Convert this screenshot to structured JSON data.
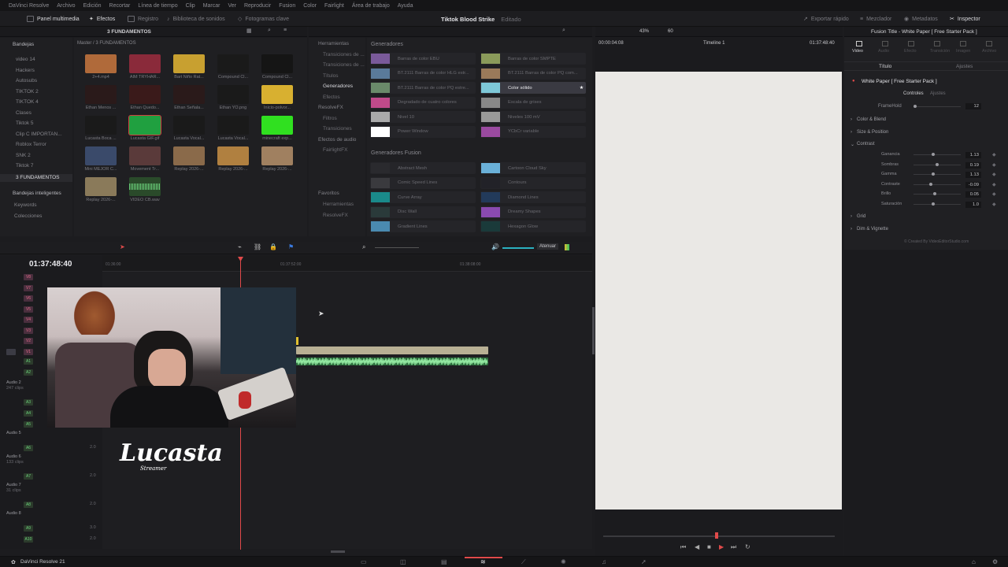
{
  "menu": [
    "DaVinci Resolve",
    "Archivo",
    "Edición",
    "Recortar",
    "Línea de tiempo",
    "Clip",
    "Marcar",
    "Ver",
    "Reproducir",
    "Fusion",
    "Color",
    "Fairlight",
    "Área de trabajo",
    "Ayuda"
  ],
  "toolbar": {
    "media_pool": "Panel multimedia",
    "effects": "Efectos",
    "index": "Registro",
    "sound_library": "Biblioteca de sonidos",
    "keyframes": "Fotogramas clave",
    "project_title": "Tiktok Blood Strike",
    "edited": "Editado",
    "quick_export": "Exportar rápido",
    "mixer": "Mezclador",
    "metadata": "Metadatos",
    "inspector": "Inspector"
  },
  "media_pool": {
    "bin_title": "3 FUNDAMENTOS",
    "breadcrumb": "Master / 3 FUNDAMENTOS",
    "bins_header": "Bandejas",
    "bins": [
      "video 14",
      "Hackers",
      "Autosubs",
      "TIKTOK 2",
      "TIKTOK 4",
      "Clases",
      "Tiktok 5",
      "Clip C IMPORTAN...",
      "Roblox Terror",
      "SNK 2",
      "Tiktok 7",
      "3 FUNDAMENTOS"
    ],
    "smart_bins_header": "Bandejas inteligentes",
    "smart_bins": [
      "Keywords",
      "Colecciones"
    ],
    "clips": [
      "2+4.mp4",
      "AIM TRYHAR...",
      "Bart Niño Rat...",
      "Compound Cl...",
      "Compound Cl...",
      "Ethan Menos ...",
      "Ethan Quedo...",
      "Ethan Señala...",
      "Ethan YO.png",
      "Inicio-polvor...",
      "Lucasta Boca ...",
      "Lucasta GIF.gif",
      "Lucasta Vocal...",
      "Lucasta Vocal...",
      "minecraft exp...",
      "Mini MEJOR C...",
      "Movement Tr...",
      "Replay 2026-...",
      "Replay 2026-...",
      "Replay 2026-...",
      "Replay 2026-...",
      "VIDEO CB.wav"
    ]
  },
  "effects": {
    "tree": [
      {
        "label": "Herramientas",
        "level": 0
      },
      {
        "label": "Transiciones de ...",
        "level": 1
      },
      {
        "label": "Transiciones de ...",
        "level": 1
      },
      {
        "label": "Títulos",
        "level": 1
      },
      {
        "label": "Generadores",
        "level": 1,
        "selected": true
      },
      {
        "label": "Efectos",
        "level": 1
      },
      {
        "label": "ResolveFX",
        "level": 0
      },
      {
        "label": "Filtros",
        "level": 1
      },
      {
        "label": "Transiciones",
        "level": 1
      },
      {
        "label": "Efectos de audio",
        "level": 0
      },
      {
        "label": "FairlightFX",
        "level": 1
      }
    ],
    "favorites_header": "Favoritos",
    "favorites": [
      "Herramientas",
      "ResolveFX"
    ],
    "generators_header": "Generadores",
    "generators": [
      {
        "label": "Barras de color EBU",
        "color": "#7a5a9a"
      },
      {
        "label": "Barras de color SMPTE",
        "color": "#8a9a5a"
      },
      {
        "label": "BT.2111 Barras de color HLG estr...",
        "color": "#5a7a9a"
      },
      {
        "label": "BT.2111 Barras de color PQ com...",
        "color": "#9a7a5a"
      },
      {
        "label": "BT.2111 Barras de color PQ estre...",
        "color": "#6a8a6a"
      },
      {
        "label": "Color sólido",
        "color": "#7ec8d8",
        "selected": true
      },
      {
        "label": "Degradado de cuatro colores",
        "color": "#c04a8a"
      },
      {
        "label": "Escala de grises",
        "color": "#888888"
      },
      {
        "label": "Nivel 10",
        "color": "#aaaaaa"
      },
      {
        "label": "Niveles 100 mV",
        "color": "#999999"
      },
      {
        "label": "Power Window",
        "color": "#ffffff"
      },
      {
        "label": "YCbCr variable",
        "color": "#9a4aa0"
      }
    ],
    "fusion_header": "Generadores Fusion",
    "fusion": [
      {
        "label": "Abstract Mesh",
        "color": "#2a2a2e"
      },
      {
        "label": "Cartoon Cloud Sky",
        "color": "#6ab0d8"
      },
      {
        "label": "Comic Speed Lines",
        "color": "#3a3a3e"
      },
      {
        "label": "Contours",
        "color": "#222228"
      },
      {
        "label": "Curve Array",
        "color": "#1a8a8a"
      },
      {
        "label": "Diamond Lines",
        "color": "#223a5a"
      },
      {
        "label": "Disc Wall",
        "color": "#2a3a3a"
      },
      {
        "label": "Dreamy Shapes",
        "color": "#8a4ab0"
      },
      {
        "label": "Gradient Lines",
        "color": "#4a8ab0"
      },
      {
        "label": "Hexagon Glow",
        "color": "#1a3a3a"
      }
    ]
  },
  "viewer": {
    "zoom": "43%",
    "fps": "60",
    "timecode_left": "00:00:04:08",
    "timeline_name": "Timeline 1",
    "timecode_right": "01:37:48:40"
  },
  "timeline": {
    "timecode": "01:37:48:40",
    "ruler": [
      "01:36:00",
      "01:37:52:00",
      "01:38:08:00"
    ],
    "mute_label": "Atenuar",
    "video_tracks": [
      "V8",
      "V7",
      "V6",
      "V5",
      "V4",
      "V3",
      "V2",
      "V1"
    ],
    "audio_tracks": [
      "A1",
      "A2",
      "A3",
      "A4",
      "A5",
      "A6",
      "A7",
      "A8",
      "A9",
      "A10"
    ],
    "audio_names": [
      {
        "name": "Audio 2",
        "sub": "247 clips"
      },
      {
        "name": "Audio 5",
        "sub": ""
      },
      {
        "name": "Audio 6",
        "sub": "133 clips"
      },
      {
        "name": "Audio 7",
        "sub": "31 clips"
      },
      {
        "name": "Audio 8",
        "sub": ""
      }
    ],
    "volume_values": [
      "2.0",
      "2.0",
      "2.0",
      "3.0",
      "2.0"
    ],
    "watermark": "Lucasta",
    "watermark_sub": "Streamer"
  },
  "inspector": {
    "title": "Fusion Title - White Paper [ Free Starter Pack ]",
    "tabs": [
      "Video",
      "Audio",
      "Efecto",
      "Transición",
      "Imagen",
      "Archivo"
    ],
    "subtabs": [
      "Título",
      "Ajustes"
    ],
    "item": "White Paper [ Free Starter Pack ]",
    "ctrl_tabs": [
      "Controles",
      "Ajustes"
    ],
    "framehold_label": "FrameHold",
    "framehold_value": "12",
    "sections": [
      "Color & Blend",
      "Size & Position",
      "Contrast"
    ],
    "contrast": [
      {
        "label": "Ganancia",
        "value": "1.13",
        "pos": 0.45
      },
      {
        "label": "Sombras",
        "value": "0.19",
        "pos": 0.55
      },
      {
        "label": "Gamma",
        "value": "1.13",
        "pos": 0.45
      },
      {
        "label": "Contraste",
        "value": "-0.09",
        "pos": 0.4
      },
      {
        "label": "Brillo",
        "value": "0.05",
        "pos": 0.5
      },
      {
        "label": "Saturación",
        "value": "1.0",
        "pos": 0.45
      }
    ],
    "more_sections": [
      "Grid",
      "Dim & Vignette"
    ],
    "credit": "© Created By VideoEditorStudio.com"
  },
  "footer": {
    "app": "DaVinci Resolve 21"
  }
}
